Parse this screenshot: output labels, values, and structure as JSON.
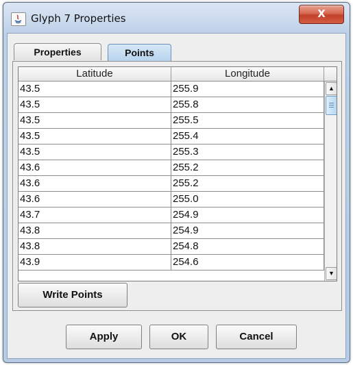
{
  "window": {
    "title": "Glyph 7 Properties",
    "close_label": "X"
  },
  "tabs": [
    {
      "label": "Properties",
      "selected": false
    },
    {
      "label": "Points",
      "selected": true
    }
  ],
  "table": {
    "columns": [
      "Latitude",
      "Longitude"
    ],
    "rows": [
      [
        "43.5",
        "255.9"
      ],
      [
        "43.5",
        "255.8"
      ],
      [
        "43.5",
        "255.5"
      ],
      [
        "43.5",
        "255.4"
      ],
      [
        "43.5",
        "255.3"
      ],
      [
        "43.6",
        "255.2"
      ],
      [
        "43.6",
        "255.2"
      ],
      [
        "43.6",
        "255.0"
      ],
      [
        "43.7",
        "254.9"
      ],
      [
        "43.8",
        "254.9"
      ],
      [
        "43.8",
        "254.8"
      ],
      [
        "43.9",
        "254.6"
      ]
    ]
  },
  "buttons": {
    "write_points": "Write Points",
    "apply": "Apply",
    "ok": "OK",
    "cancel": "Cancel"
  },
  "icons": {
    "app": "java-icon",
    "scroll_up": "arrow-up-icon",
    "scroll_down": "arrow-down-icon"
  },
  "colors": {
    "title_gradient": "#c8d8ec",
    "close_button": "#c2402a",
    "selected_tab": "#b8d4ee",
    "scroll_thumb": "#b9d8f2"
  }
}
